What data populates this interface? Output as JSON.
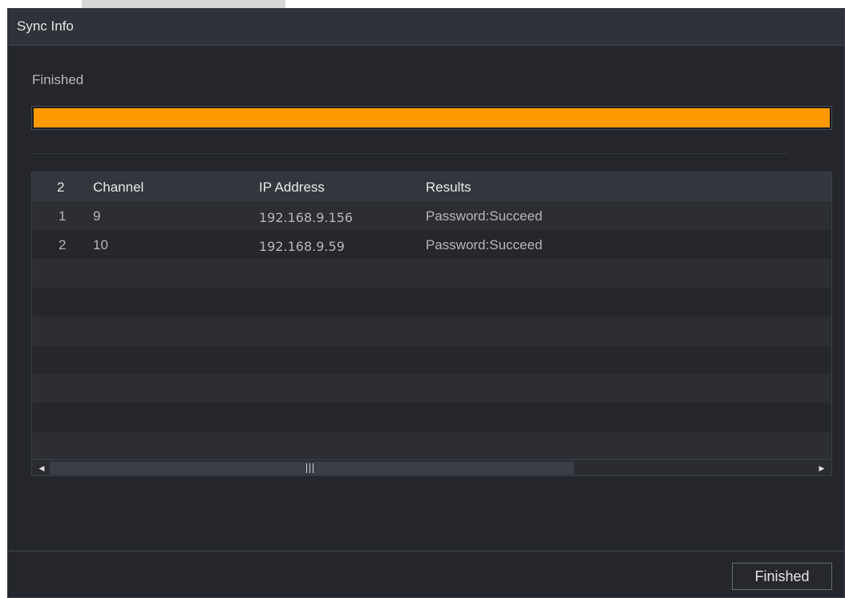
{
  "dialog": {
    "title": "Sync Info",
    "status": "Finished",
    "progress": 1.0,
    "accent_color": "#ff9900"
  },
  "table": {
    "headers": [
      "2",
      "Channel",
      "IP Address",
      "Results"
    ],
    "rows": [
      [
        "1",
        "9",
        "192.168.9.156",
        "Password:Succeed"
      ],
      [
        "2",
        "10",
        "192.168.9.59",
        "Password:Succeed"
      ]
    ],
    "empty_row_count": 7,
    "scrollbar": {
      "left_icon": "triangle-left-icon",
      "right_icon": "triangle-right-icon",
      "grip_icon": "grip-lines-icon"
    }
  },
  "footer": {
    "finish_label": "Finished"
  }
}
